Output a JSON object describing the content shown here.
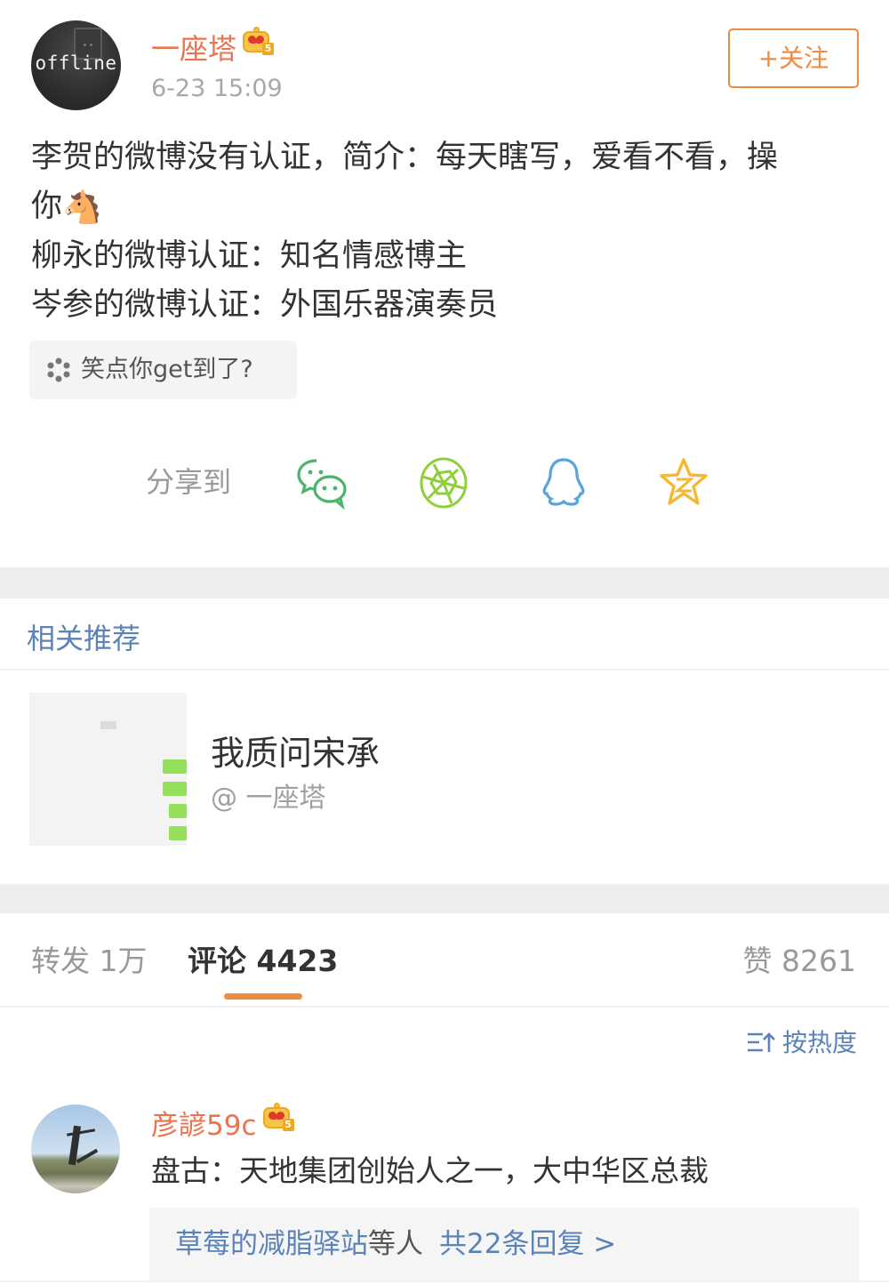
{
  "post": {
    "avatar_text": "offline",
    "user_name": "一座塔",
    "vip_level": "5",
    "time": "6-23 15:09",
    "follow_label": "+关注",
    "body_lines": [
      "李贺的微博没有认证，简介：每天瞎写，爱看不看，操",
      "你",
      "柳永的微博认证：知名情感博主",
      "岑参的微博认证：外国乐器演奏员"
    ],
    "horse_emoji": "🐴",
    "topic_tag": "笑点你get到了?",
    "share": {
      "label": "分享到",
      "targets": [
        {
          "name": "wechat",
          "icon": "wechat-icon",
          "color": "#4bb56a"
        },
        {
          "name": "moments",
          "icon": "moments-icon",
          "color": "#8fcf3a"
        },
        {
          "name": "qq",
          "icon": "qq-icon",
          "color": "#56a6dc"
        },
        {
          "name": "qzone",
          "icon": "qzone-icon",
          "color": "#f6b830"
        }
      ]
    }
  },
  "related": {
    "title": "相关推荐",
    "items": [
      {
        "name": "我质问宋承",
        "author": "@ 一座塔"
      }
    ]
  },
  "tabs": {
    "repost": "转发 1万",
    "comment": "评论 4423",
    "like": "赞 8261",
    "active": "comment"
  },
  "sort": {
    "label": "按热度"
  },
  "comments": [
    {
      "user": "彦諺59c",
      "vip_level": "5",
      "text": "盘古：天地集团创始人之一，大中华区总裁",
      "replies_names": "草莓的减脂驿站",
      "replies_suffix": "等人",
      "replies_count": "共22条回复 >"
    }
  ],
  "colors": {
    "accent_orange": "#f08a3c",
    "name_orange": "#eb7350",
    "link_blue": "#5b83b8",
    "band_gray": "#eeeeee"
  }
}
